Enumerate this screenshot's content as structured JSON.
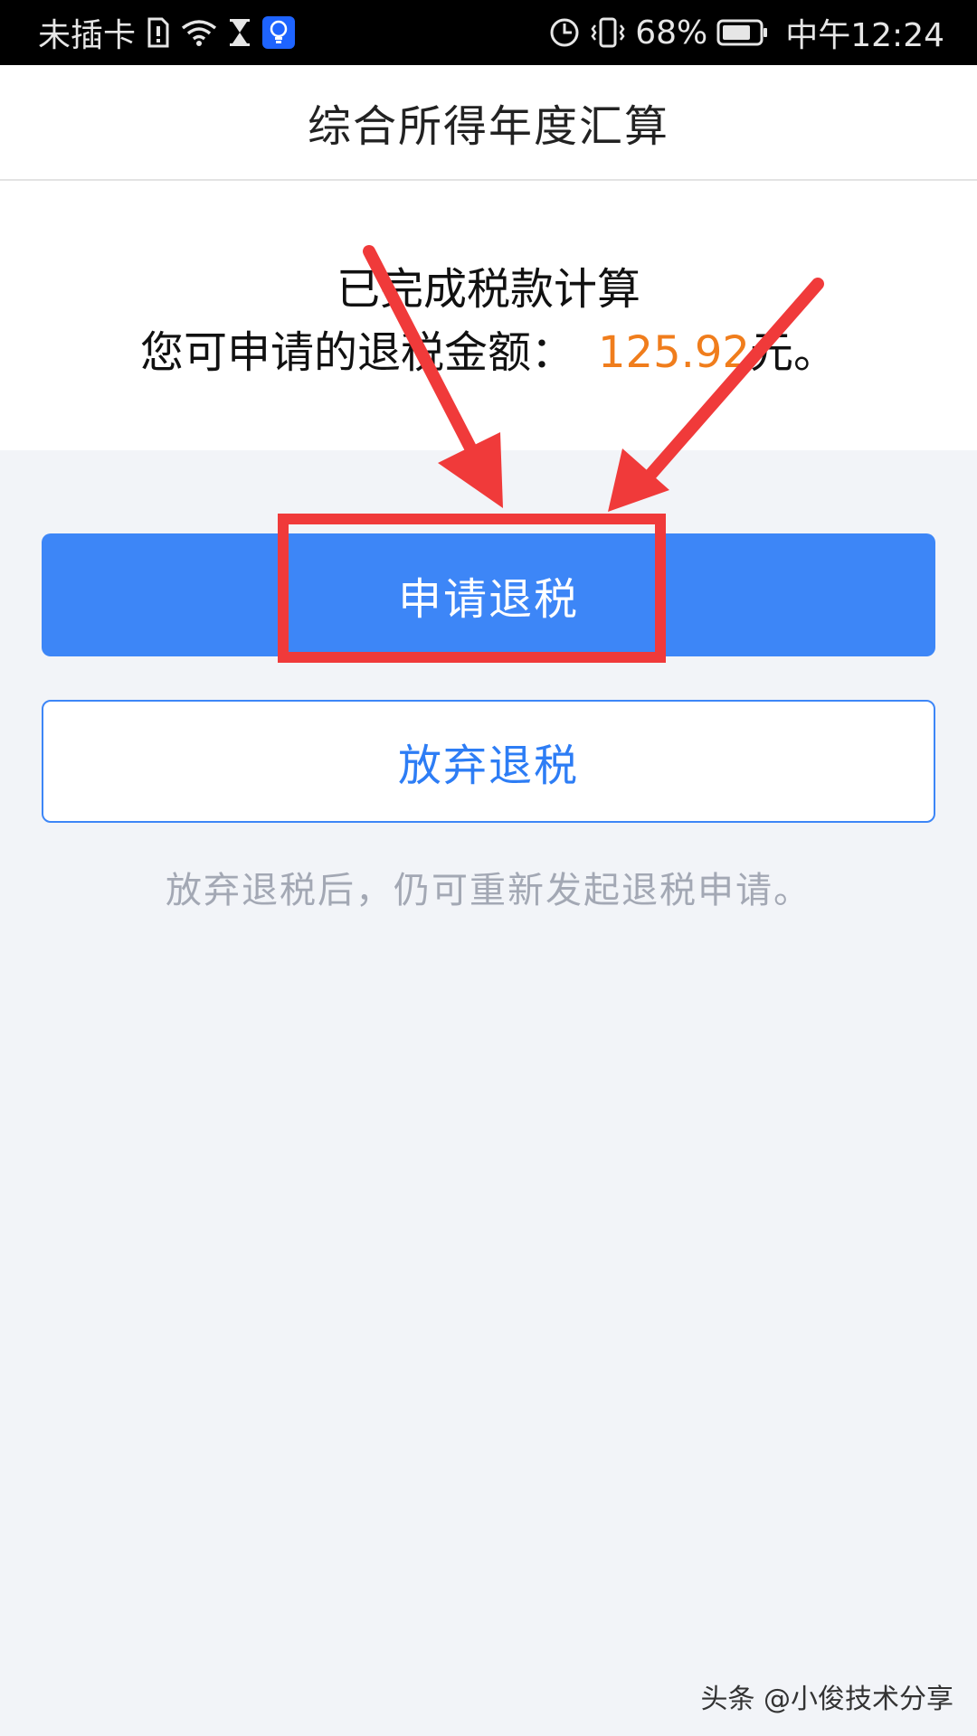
{
  "status_bar": {
    "carrier": "未插卡",
    "battery": "68%",
    "time": "中午12:24"
  },
  "header": {
    "title": "综合所得年度汇算"
  },
  "result": {
    "line1": "已完成税款计算",
    "line2_label": "您可申请的退税金额：",
    "amount": "125.92",
    "unit": "元。"
  },
  "buttons": {
    "apply_label": "申请退税",
    "giveup_label": "放弃退税"
  },
  "note": "放弃退税后，仍可重新发起退税申请。",
  "watermark": "头条 @小俊技术分享",
  "colors": {
    "primary": "#3d86f7",
    "amount": "#f07d1c",
    "annotation": "#f03a3a"
  },
  "icons": [
    "sim-missing-icon",
    "wifi-icon",
    "hourglass-icon",
    "lightbulb-icon",
    "data-saver-icon",
    "vibrate-icon",
    "battery-icon"
  ]
}
